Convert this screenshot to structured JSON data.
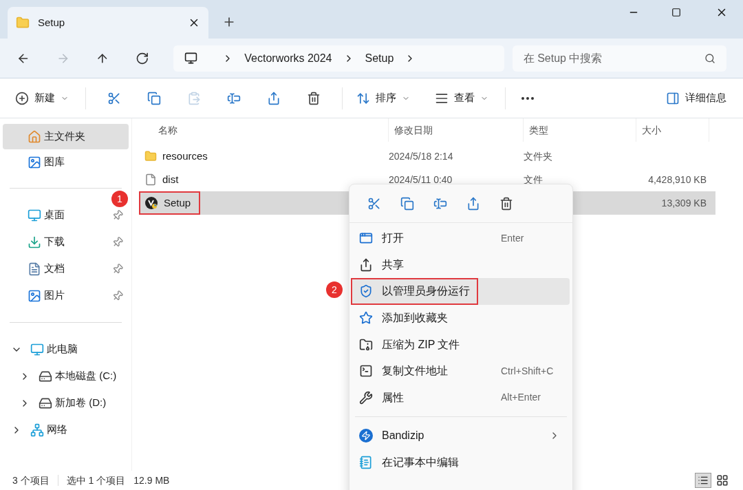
{
  "tab": {
    "title": "Setup"
  },
  "nav": [
    {
      "kind": "back",
      "disabled": false
    },
    {
      "kind": "forward",
      "disabled": true
    },
    {
      "kind": "up",
      "disabled": false
    },
    {
      "kind": "refresh",
      "disabled": false
    }
  ],
  "breadcrumb": [
    "Vectorworks 2024",
    "Setup"
  ],
  "search": {
    "placeholder": "在 Setup 中搜索"
  },
  "toolbar": {
    "new": "新建",
    "actions": [
      {
        "kind": "cut",
        "disabled": false
      },
      {
        "kind": "copy",
        "disabled": false
      },
      {
        "kind": "paste",
        "disabled": true
      },
      {
        "kind": "rename",
        "disabled": false
      },
      {
        "kind": "share",
        "disabled": false
      },
      {
        "kind": "delete",
        "disabled": false
      }
    ],
    "sort": "排序",
    "view": "查看",
    "details": "详细信息"
  },
  "sidebar": {
    "quick": [
      {
        "kind": "home",
        "label": "主文件夹",
        "selected": true,
        "pinned": false
      },
      {
        "kind": "gallery",
        "label": "图库",
        "selected": false,
        "pinned": false
      }
    ],
    "pinned": [
      {
        "kind": "desktop",
        "label": "桌面",
        "selected": false,
        "pinned": true
      },
      {
        "kind": "downloads",
        "label": "下载",
        "selected": false,
        "pinned": true
      },
      {
        "kind": "documents",
        "label": "文档",
        "selected": false,
        "pinned": true
      },
      {
        "kind": "pictures",
        "label": "图片",
        "selected": false,
        "pinned": true
      }
    ],
    "tree": [
      {
        "kind": "pc",
        "label": "此电脑",
        "expanded": true,
        "children": [
          {
            "kind": "drive",
            "label": "本地磁盘 (C:)",
            "expanded": false
          },
          {
            "kind": "drive",
            "label": "新加卷 (D:)",
            "expanded": false
          }
        ]
      },
      {
        "kind": "network",
        "label": "网络",
        "expanded": false
      }
    ]
  },
  "table": {
    "columns": [
      "名称",
      "修改日期",
      "类型",
      "大小"
    ],
    "rows": [
      {
        "kind": "folder",
        "name": "resources",
        "date": "2024/5/18 2:14",
        "type": "文件夹",
        "selected": false
      },
      {
        "kind": "file",
        "name": "dist",
        "date": "2024/5/11 0:40",
        "type": "文件",
        "size": "4,428,910 KB",
        "selected": false
      },
      {
        "kind": "app",
        "name": "Setup",
        "size": "13,309 KB",
        "selected": true,
        "marker": "1"
      }
    ]
  },
  "context_menu": {
    "quick_actions": [
      {
        "kind": "cut"
      },
      {
        "kind": "copy"
      },
      {
        "kind": "rename"
      },
      {
        "kind": "share"
      },
      {
        "kind": "delete"
      }
    ],
    "groups": [
      {
        "items": [
          {
            "kind": "open",
            "label": "打开",
            "shortcut": "Enter",
            "selected": false
          },
          {
            "kind": "share",
            "label": "共享",
            "selected": false
          },
          {
            "kind": "admin",
            "label": "以管理员身份运行",
            "selected": true,
            "marker": "2"
          },
          {
            "kind": "favorite",
            "label": "添加到收藏夹",
            "selected": false
          },
          {
            "kind": "zip",
            "label": "压缩为 ZIP 文件",
            "selected": false
          },
          {
            "kind": "path",
            "label": "复制文件地址",
            "shortcut": "Ctrl+Shift+C",
            "selected": false
          },
          {
            "kind": "properties",
            "label": "属性",
            "shortcut": "Alt+Enter",
            "selected": false
          }
        ]
      },
      {
        "items": [
          {
            "kind": "bandizip",
            "label": "Bandizip",
            "submenu": true,
            "selected": false
          },
          {
            "kind": "notepad",
            "label": "在记事本中编辑",
            "selected": false
          }
        ]
      }
    ]
  },
  "status_bar": {
    "count": "3 个项目",
    "selection": "选中 1 个项目",
    "size": "12.9 MB",
    "views": [
      {
        "kind": "details",
        "selected": true
      },
      {
        "kind": "tiles",
        "selected": false
      }
    ]
  }
}
